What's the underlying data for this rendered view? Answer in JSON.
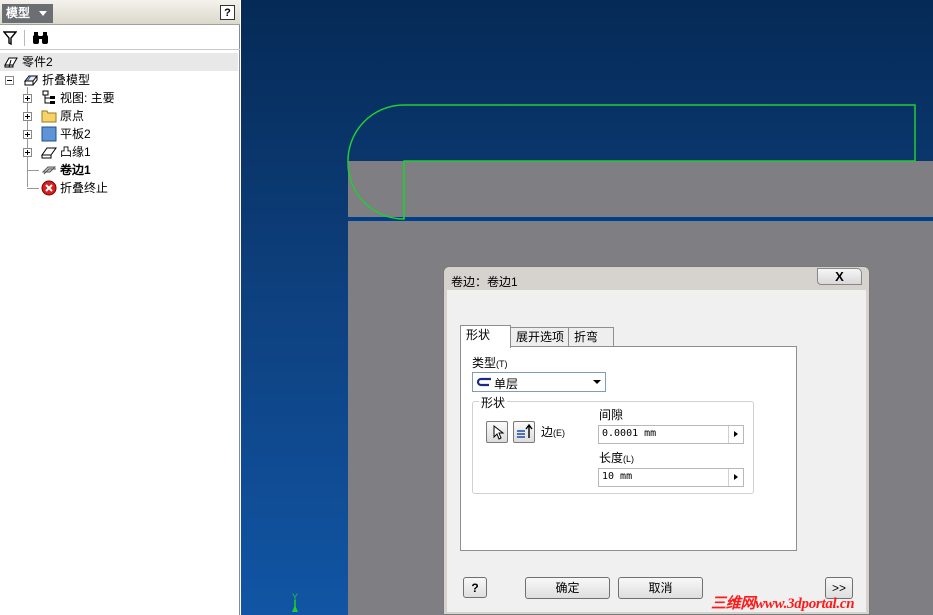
{
  "browser": {
    "tab_label": "模型",
    "help_label": "?",
    "tree": {
      "root": "零件2",
      "folded_model": "折叠模型",
      "children": [
        {
          "label": "视图:  主要",
          "icon": "view-representation-icon"
        },
        {
          "label": "原点",
          "icon": "folder-icon"
        },
        {
          "label": "平板2",
          "icon": "face-feature-icon"
        },
        {
          "label": "凸缘1",
          "icon": "flange-feature-icon"
        },
        {
          "label": "卷边1",
          "icon": "hem-feature-icon"
        },
        {
          "label": "折叠终止",
          "icon": "end-of-folded-icon"
        }
      ]
    }
  },
  "dialog": {
    "title": "卷边：卷边1",
    "close_label": "X",
    "tabs": [
      "形状",
      "展开选项",
      "折弯"
    ],
    "active_tab": "形状",
    "type_label": "类型",
    "type_key": "(T)",
    "type_value": "单层",
    "shape_group_label": "形状",
    "edge_label": "边",
    "edge_key": "(E)",
    "gap_label": "间隙",
    "gap_value": "0.0001 mm",
    "length_label": "长度",
    "length_key": "(L)",
    "length_value": "10 mm",
    "help_label": "?",
    "ok_label": "确定",
    "cancel_label": "取消",
    "more_label": ">>"
  },
  "viewport": {
    "axis_label": "Y",
    "sketch_color": "#22cc33",
    "part_color": "#7f7e82"
  },
  "watermark": "三维网www.3dportal.cn"
}
